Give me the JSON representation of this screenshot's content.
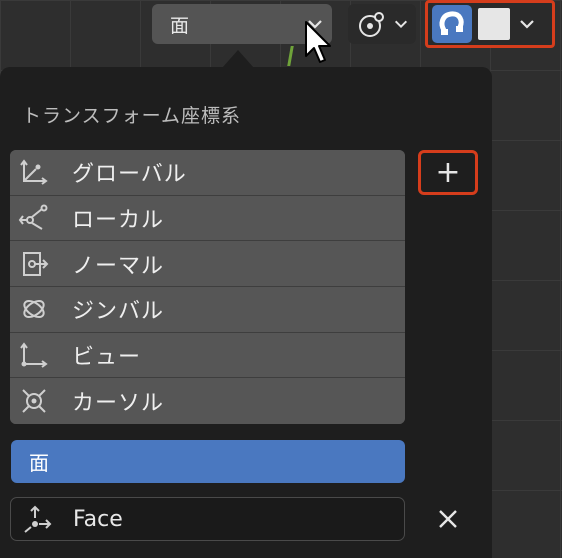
{
  "header": {
    "orientation_value": "面",
    "orientation_icon": "chevron-down-icon",
    "pivot_icon": "pivot-icon",
    "snap_icon": "magnet-icon",
    "accent_color": "#4a78c0",
    "highlight_color": "#d53d1c"
  },
  "panel": {
    "title": "トランスフォーム座標系",
    "items": [
      {
        "label": "グローバル",
        "icon": "global-axes-icon"
      },
      {
        "label": "ローカル",
        "icon": "local-axes-icon"
      },
      {
        "label": "ノーマル",
        "icon": "normal-axes-icon"
      },
      {
        "label": "ジンバル",
        "icon": "gimbal-icon"
      },
      {
        "label": "ビュー",
        "icon": "view-axes-icon"
      },
      {
        "label": "カーソル",
        "icon": "cursor-axes-icon"
      }
    ],
    "add_label": "+",
    "custom_items": [
      {
        "label": "面"
      }
    ],
    "name_field_value": "Face",
    "delete_icon": "close-icon"
  }
}
